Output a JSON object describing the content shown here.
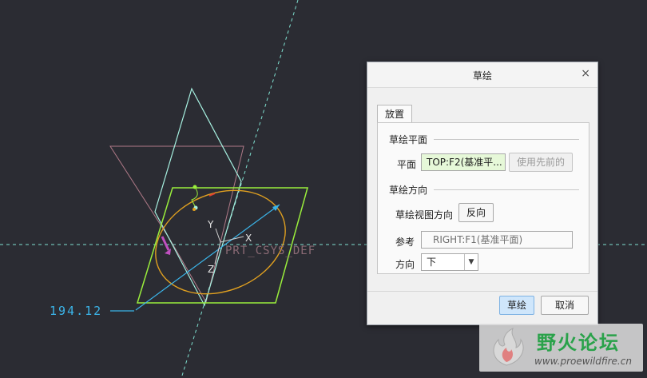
{
  "viewport": {
    "dimension_value": "194.12",
    "axis_x": "X",
    "axis_y": "Y",
    "axis_z": "Z",
    "csys_label": "PRT_CSYS_DEF"
  },
  "dialog": {
    "title": "草绘",
    "close_glyph": "×",
    "tab_label": "放置",
    "sketch_plane": {
      "section_title": "草绘平面",
      "plane_label": "平面",
      "plane_value": "TOP:F2(基准平...",
      "use_previous_label": "使用先前的"
    },
    "sketch_orientation": {
      "section_title": "草绘方向",
      "view_dir_label": "草绘视图方向",
      "flip_label": "反向",
      "reference_label": "参考",
      "reference_value": "RIGHT:F1(基准平面)",
      "orientation_label": "方向",
      "orientation_value": "下"
    },
    "ok_label": "草绘",
    "cancel_label": "取消"
  },
  "watermark": {
    "title": "野火论坛",
    "url": "www.proewildfire.cn"
  },
  "colors": {
    "background": "#2b2c33",
    "dimension": "#3bb4e8",
    "datum_plane_selected": "#9aee3c",
    "datum_plane": "#a6f0e0",
    "sketch_circle": "#e0a020",
    "field_highlight": "#e6f8d8"
  }
}
